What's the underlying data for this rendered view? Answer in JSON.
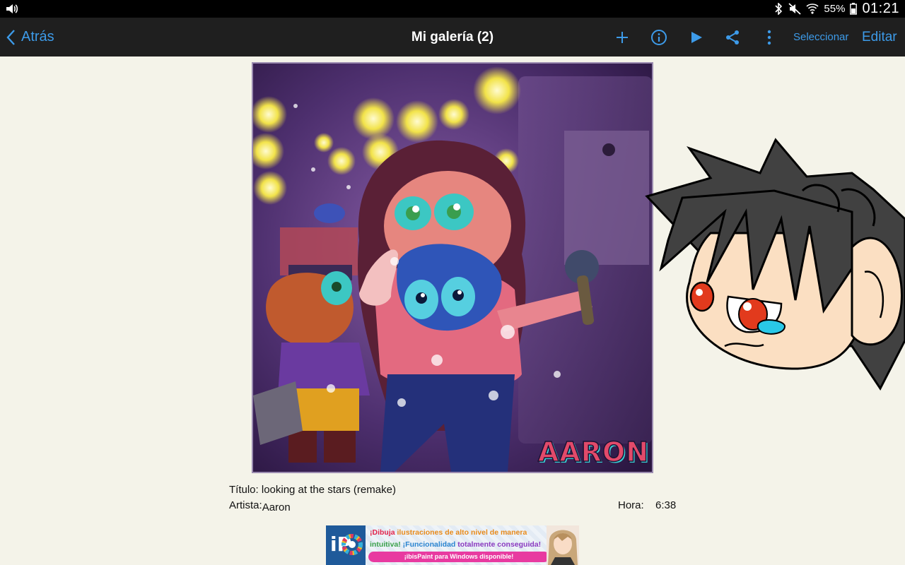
{
  "status_bar": {
    "battery": "55%",
    "time": "01:21",
    "icons": [
      "volume-icon",
      "bluetooth-icon",
      "mute-icon",
      "wifi-icon",
      "battery-icon"
    ]
  },
  "action_bar": {
    "back_label": "Atrás",
    "title": "Mi galería (2)",
    "select_label": "Seleccionar",
    "edit_label": "Editar",
    "icons": [
      "plus-icon",
      "info-icon",
      "play-icon",
      "share-icon",
      "more-vert-icon"
    ],
    "accent_color": "#3d9be9"
  },
  "artwork": {
    "signature": "AARON"
  },
  "details": {
    "title_label": "Título:",
    "title_value": "looking at the stars (remake)",
    "artist_label": "Artista:",
    "artist_value": "Aaron",
    "time_label": "Hora:",
    "time_value": "6:38"
  },
  "ad": {
    "logo": "iP",
    "line1_a": "¡Dibuja ",
    "line1_b": "ilustraciones de alto nivel de manera",
    "line2_a": "intuitiva! ",
    "line2_b": "¡Funcionalidad ",
    "line2_c": "totalmente conseguida!",
    "button": "¡ibisPaint para Windows disponible!"
  }
}
